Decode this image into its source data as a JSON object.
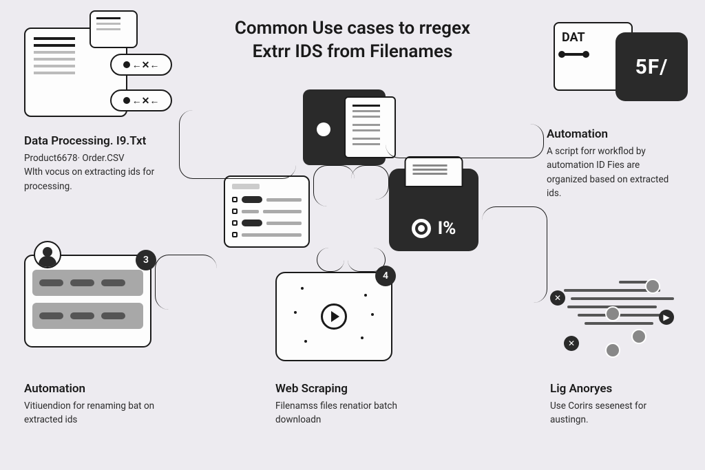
{
  "title_line1": "Common Use cases to rregex",
  "title_line2": "Extrr IDS from Filenames",
  "topleft": {
    "heading": "Data Processing. I9.Txt",
    "sub": "Product6678· Order.CSV",
    "desc": "Wlth vocus on extracting ids for processing."
  },
  "topright": {
    "dat": "DAT",
    "code": "5F/",
    "heading": "Automation",
    "desc": "A script forr workflod by automation ID Fies are organized based on extracted ids."
  },
  "centerright_label": "I%",
  "left_auto": {
    "badge": "3",
    "heading": "Automation",
    "desc": "Vitiuendion for renaming bat on extracted ids"
  },
  "web_scraping": {
    "badge": "4",
    "heading": "Web Scraping",
    "desc": "Filenamss files renatior batch downloadn"
  },
  "log_analysis": {
    "heading": "Lig Anoryes",
    "desc": "Use Corirs sesenest for austingn."
  }
}
